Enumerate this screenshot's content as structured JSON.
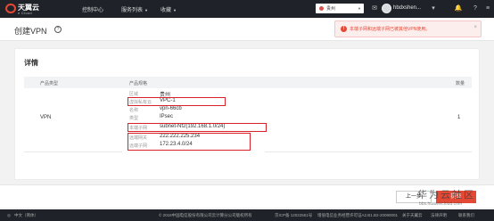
{
  "header": {
    "brand": "天翼云",
    "brand_sub": "e Cloud",
    "nav": [
      {
        "label": "控制中心"
      },
      {
        "label": "服务列表"
      },
      {
        "label": "收藏"
      }
    ],
    "region": "贵州",
    "user": "hbdxshen..."
  },
  "page": {
    "title": "创建VPN",
    "help": "?"
  },
  "toast": {
    "message": "本端子网和远端子网已被其他VPN使用。",
    "close": "×"
  },
  "details": {
    "title": "详情",
    "columns": {
      "type": "产品类型",
      "spec": "产品规格",
      "qty": "数量"
    },
    "row": {
      "type": "VPN",
      "qty": "1",
      "spec": [
        {
          "label": "区域",
          "value": "贵州"
        },
        {
          "label": "虚拟私有云",
          "value": "VPC-1"
        },
        {
          "label": "名称",
          "value": "vpn-66cb"
        },
        {
          "label": "类型",
          "value": "IPsec"
        },
        {
          "label": "本端子网",
          "value": "subnet-Nf2(192.168.1.0/24)"
        },
        {
          "label": "远端网关",
          "value": "222.222.225.234"
        },
        {
          "label": "远端子网",
          "value": "172.23.4.0/24"
        }
      ]
    }
  },
  "actions": {
    "prev": "上一步",
    "submit": "提交"
  },
  "watermark": {
    "text": "华为云社区",
    "url": "bbs.huaweicloud.com"
  },
  "footer": {
    "lang": "中文（简体）",
    "copyright": "© 2018中国电信股份有限公司云计算分公司版权所有",
    "icp": "京ICP备 12022551号",
    "license": "增值电信业务经营许可证A2.B1.B2-20090001",
    "links": [
      "关于天翼云",
      "法律声明",
      "联系我们"
    ]
  },
  "colors": {
    "accent": "#e34935",
    "topbar": "#1f2329",
    "highlight": "#d9212a"
  }
}
